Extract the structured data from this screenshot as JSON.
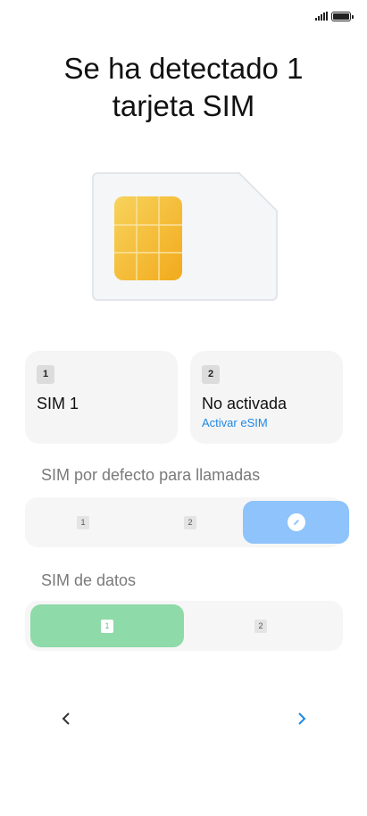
{
  "page": {
    "title_line1": "Se ha detectado 1",
    "title_line2": "tarjeta SIM"
  },
  "status_bar": {
    "signal_icon": "signal-bars-icon",
    "battery_icon": "battery-full-icon",
    "battery_level": 1.0
  },
  "sim_cards": [
    {
      "slot": "1",
      "name": "SIM 1",
      "link": ""
    },
    {
      "slot": "2",
      "name": "No activada",
      "link": "Activar eSIM"
    }
  ],
  "calls_section": {
    "label": "SIM por defecto para llamadas",
    "options": [
      {
        "badge": "1",
        "selected": false
      },
      {
        "badge": "2",
        "selected": false
      },
      {
        "icon": "edit-icon",
        "selected": true
      }
    ],
    "accent": "#8ec3fb"
  },
  "data_section": {
    "label": "SIM de datos",
    "options": [
      {
        "badge": "1",
        "selected": true
      },
      {
        "badge": "2",
        "selected": false
      }
    ],
    "accent": "#8edaa9"
  },
  "nav": {
    "back_icon": "chevron-left-icon",
    "next_icon": "chevron-right-icon",
    "next_color": "#1e88e5"
  }
}
